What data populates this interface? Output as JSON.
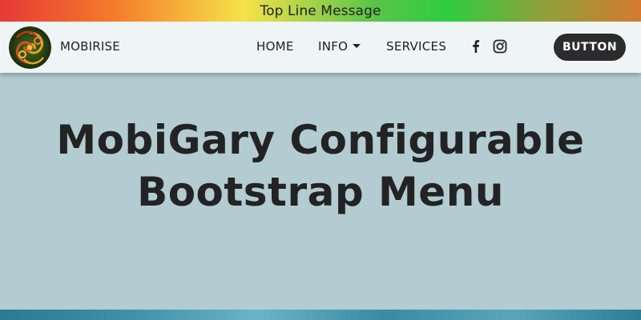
{
  "top_message": "Top Line Message",
  "navbar": {
    "brand": "MOBIRISE",
    "logo_icon": "mobirise-swirl-logo-icon",
    "links": [
      {
        "label": "HOME"
      },
      {
        "label": "INFO",
        "has_dropdown": true
      },
      {
        "label": "SERVICES"
      }
    ],
    "social": [
      "facebook-icon",
      "instagram-icon"
    ],
    "button_label": "BUTTON"
  },
  "hero": {
    "title_line1": "MobiGary Configurable",
    "title_line2": "Bootstrap Menu"
  },
  "colors": {
    "navbar_bg": "#eff4f5",
    "hero_bg": "#b2ccd2",
    "button_bg": "#2c2c2c",
    "text": "#232323"
  }
}
